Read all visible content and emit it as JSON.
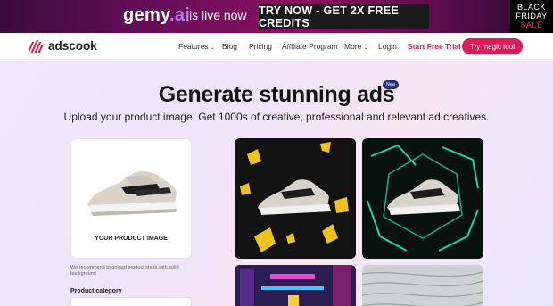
{
  "promo": {
    "brand_name": "gemy",
    "brand_dot": ".",
    "brand_suffix": "ai",
    "live_text": "is live now",
    "cta_label": "TRY NOW - GET 2X FREE CREDITS",
    "bf_line1": "BLACK",
    "bf_line2": "FRIDAY",
    "bf_line3": "SALE"
  },
  "nav": {
    "logo_text": "adscook",
    "items": [
      "Features",
      "Blog",
      "Pricing",
      "Affiliate Program",
      "More",
      "Login"
    ],
    "trial_label": "Start Free Trial",
    "magic_label": "Try magic tool"
  },
  "hero": {
    "title": "Generate stunning ads",
    "badge": "New",
    "subtitle": "Upload your product image. Get 1000s of creative, professional and relevant ad creatives."
  },
  "product": {
    "label": "YOUR PRODUCT IMAGE",
    "note": "We recommend to upload product shots with solid background",
    "category_label": "Product category"
  },
  "colors": {
    "accent": "#e0195a",
    "promo_bg": "#6a0d5a",
    "badge_bg": "#2a2f7a"
  }
}
